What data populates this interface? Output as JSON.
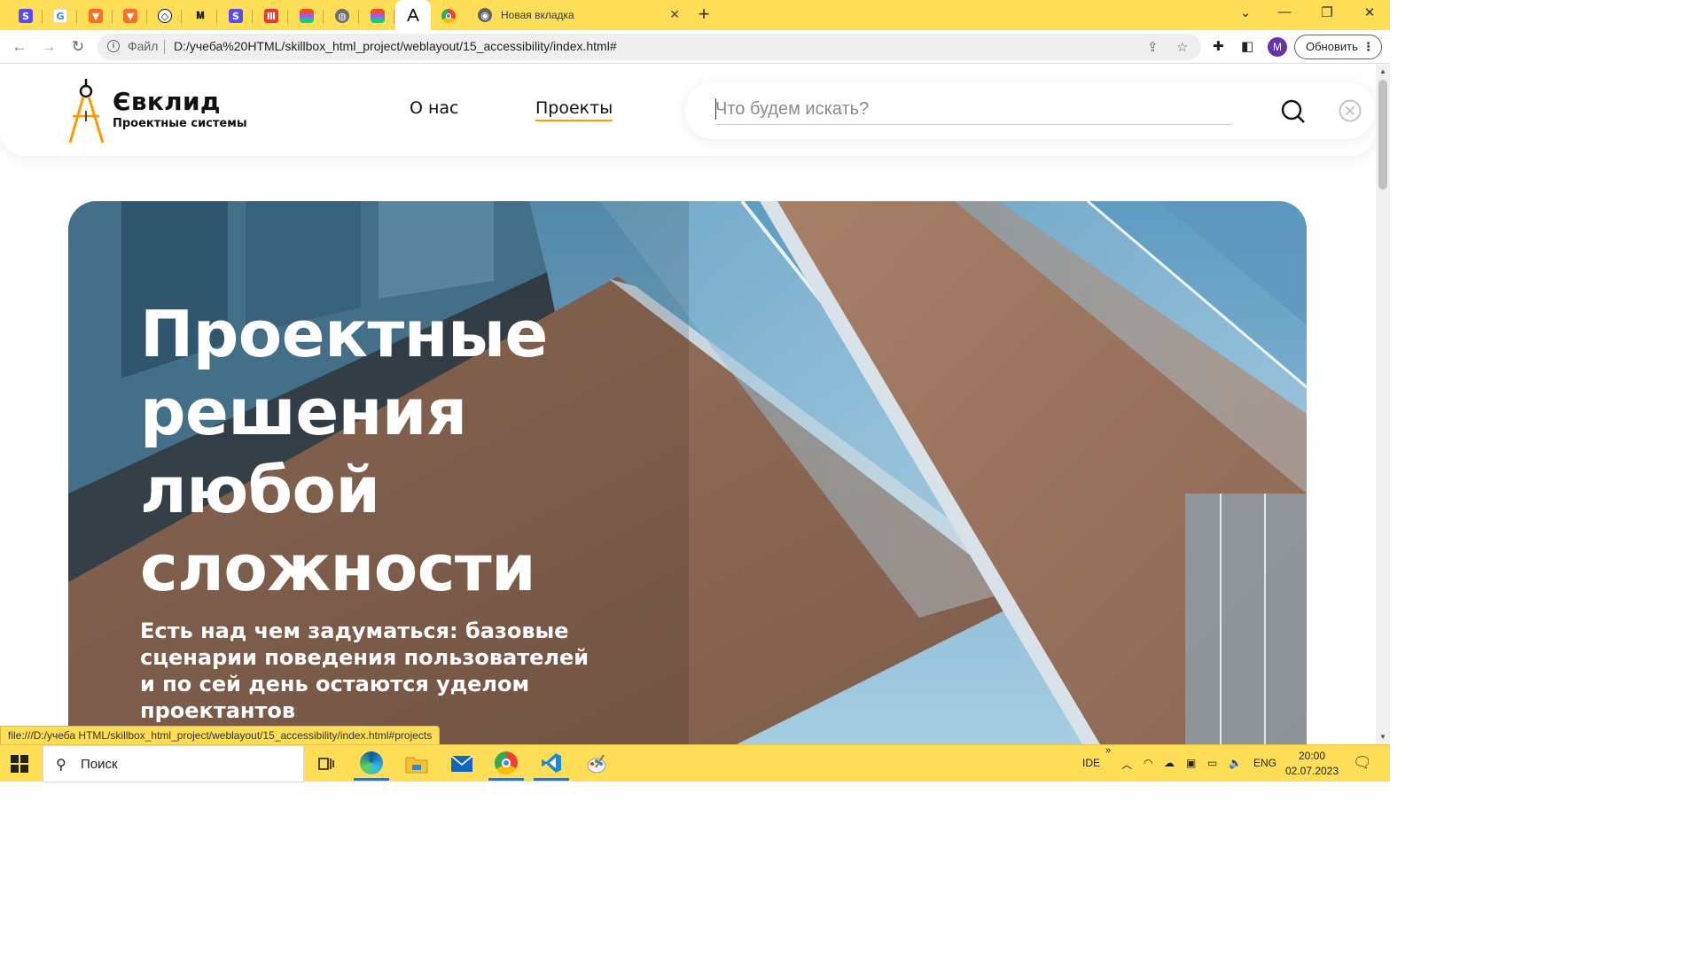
{
  "browser": {
    "tabs": [
      {
        "icon": "s-logo-icon",
        "glyph": "S",
        "color": "#5a4cf0"
      },
      {
        "icon": "google-icon",
        "glyph": "G",
        "color": "#ffffff"
      },
      {
        "icon": "gitlab-icon",
        "glyph": "🦊",
        "color": "#fc6d26"
      },
      {
        "icon": "gitlab-icon-2",
        "glyph": "🦊",
        "color": "#fc6d26"
      },
      {
        "icon": "codepen-icon",
        "glyph": "⬡",
        "color": "#ffffff"
      },
      {
        "icon": "bem-icon",
        "glyph": "Ⅱ",
        "color": "#ffffff"
      },
      {
        "icon": "s-logo-icon-2",
        "glyph": "S",
        "color": "#5a4cf0"
      },
      {
        "icon": "red-book-icon",
        "glyph": "Ⅲ",
        "color": "#e53935"
      },
      {
        "icon": "figma-icon",
        "glyph": "◆",
        "color": "#ffffff"
      },
      {
        "icon": "globe-icon",
        "glyph": "◍",
        "color": "#ffffff"
      },
      {
        "icon": "figma-icon-2",
        "glyph": "◆",
        "color": "#ffffff"
      },
      {
        "icon": "compass-icon",
        "glyph": "⋀",
        "color": "#ffffff",
        "active": true
      },
      {
        "icon": "chrome-icon",
        "glyph": "◉",
        "color": "#ffffff"
      }
    ],
    "new_tab_label": "Новая вкладка",
    "address": {
      "scheme_label": "Файл",
      "url": "D:/учеба%20HTML/skillbox_html_project/weblayout/15_accessibility/index.html#"
    },
    "profile_initial": "M",
    "update_label": "Обновить",
    "status_url": "file:///D:/учеба HTML/skillbox_html_project/weblayout/15_accessibility/index.html#projects"
  },
  "site": {
    "logo": {
      "name": "Євклид",
      "subtitle": "Проектные системы"
    },
    "nav": [
      {
        "label": "О нас",
        "active": false
      },
      {
        "label": "Проекты",
        "active": true
      }
    ],
    "search": {
      "placeholder": "Что будем искать?",
      "value": ""
    },
    "hero": {
      "title": "Проектные решения любой сложности",
      "text": "Есть над чем задуматься: базовые сценарии поведения пользователей и по сей день остаются уделом проектантов"
    },
    "accent_color": "#ff9900"
  },
  "taskbar": {
    "search_placeholder": "Поиск",
    "apps": [
      "task-view-icon",
      "edge-icon",
      "file-explorer-icon",
      "mail-icon",
      "chrome-icon",
      "vscode-icon",
      "paint-icon"
    ],
    "tray": {
      "ide": "IDE",
      "lang": "ENG",
      "time": "20:00",
      "date": "02.07.2023"
    }
  }
}
